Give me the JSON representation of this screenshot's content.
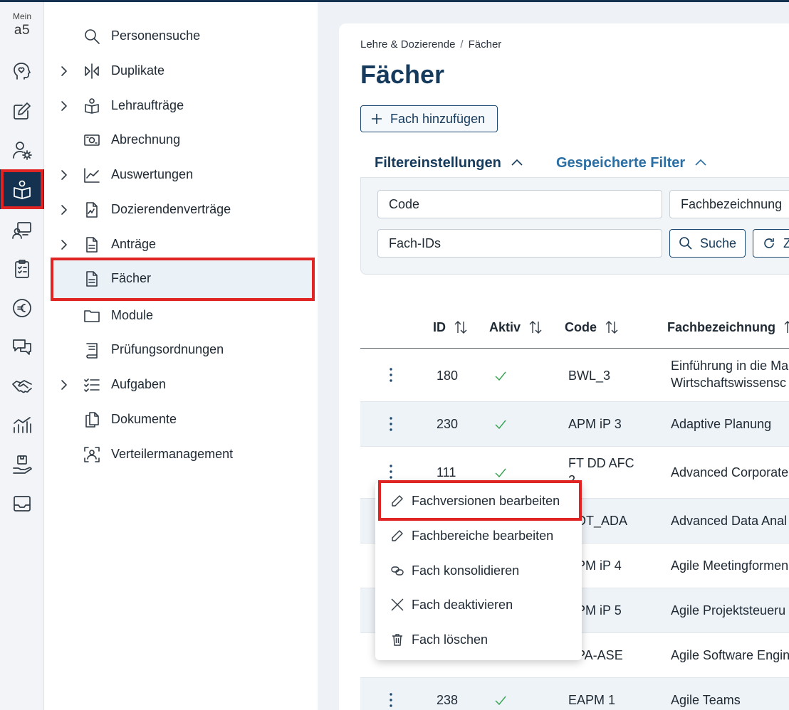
{
  "rail": {
    "brand_top": "Mein",
    "brand_logo": "a5",
    "icons": [
      "head-heart-icon",
      "edit-icon",
      "user-settings-icon",
      "teaching-book-icon",
      "presentation-user-icon",
      "clipboard-list-icon",
      "euro-icon",
      "chat-icon",
      "handshake-icon",
      "chart-icon",
      "hand-box-icon",
      "inbox-icon"
    ],
    "active_index": 3
  },
  "nav": {
    "items": [
      {
        "label": "Personensuche",
        "icon": "search-icon",
        "expandable": false
      },
      {
        "label": "Duplikate",
        "icon": "compare-icon",
        "expandable": true
      },
      {
        "label": "Lehraufträge",
        "icon": "book-user-icon",
        "expandable": true
      },
      {
        "label": "Abrechnung",
        "icon": "banknote-icon",
        "expandable": false
      },
      {
        "label": "Auswertungen",
        "icon": "line-chart-icon",
        "expandable": true
      },
      {
        "label": "Dozierendenverträge",
        "icon": "contract-icon",
        "expandable": true
      },
      {
        "label": "Anträge",
        "icon": "document-icon",
        "expandable": true
      },
      {
        "label": "Fächer",
        "icon": "document-icon",
        "expandable": false,
        "selected": true
      },
      {
        "label": "Module",
        "icon": "folder-icon",
        "expandable": false
      },
      {
        "label": "Prüfungsordnungen",
        "icon": "book-icon",
        "expandable": false
      },
      {
        "label": "Aufgaben",
        "icon": "checklist-icon",
        "expandable": true
      },
      {
        "label": "Dokumente",
        "icon": "documents-icon",
        "expandable": false
      },
      {
        "label": "Verteilermanagement",
        "icon": "group-scan-icon",
        "expandable": false
      }
    ]
  },
  "main": {
    "breadcrumb": [
      "Lehre & Dozierende",
      "Fächer"
    ],
    "breadcrumb_sep": "/",
    "title": "Fächer",
    "add_button": "Fach hinzufügen",
    "tabs": [
      "Filtereinstellungen",
      "Gespeicherte Filter"
    ],
    "filters": {
      "code_placeholder": "Code",
      "name_placeholder": "Fachbezeichnung",
      "ids_placeholder": "Fach-IDs",
      "search_button": "Suche",
      "reset_button": "Zurücksetzen"
    },
    "table": {
      "columns": [
        "ID",
        "Aktiv",
        "Code",
        "Fachbezeichnung"
      ],
      "rows": [
        {
          "id": "180",
          "active": true,
          "code": "BWL_3",
          "name": "Einführung in die Ma",
          "name2": "Wirtschaftswissensc"
        },
        {
          "id": "230",
          "active": true,
          "code": "APM iP 3",
          "name": "Adaptive Planung"
        },
        {
          "id": "111",
          "active": true,
          "code": "FT DD AFC",
          "code2": "2",
          "name": "Advanced Corporate"
        },
        {
          "id": "",
          "active": true,
          "code": "ADT_ADA",
          "name": "Advanced Data Anal"
        },
        {
          "id": "",
          "active": true,
          "code": "APM iP 4",
          "name": "Agile Meetingformen"
        },
        {
          "id": "",
          "active": true,
          "code": "APM iP 5",
          "name": "Agile Projektsteueru"
        },
        {
          "id": "",
          "active": true,
          "code": "APA-ASE",
          "name": "Agile Software Engin"
        },
        {
          "id": "238",
          "active": true,
          "code": "EAPM 1",
          "name": "Agile Teams"
        }
      ]
    }
  },
  "context_menu": {
    "items": [
      {
        "label": "Fachversionen bearbeiten",
        "icon": "pencil-icon"
      },
      {
        "label": "Fachbereiche bearbeiten",
        "icon": "pencil-icon"
      },
      {
        "label": "Fach konsolidieren",
        "icon": "merge-icon"
      },
      {
        "label": "Fach deaktivieren",
        "icon": "close-icon"
      },
      {
        "label": "Fach löschen",
        "icon": "trash-icon"
      }
    ]
  },
  "colors": {
    "brand_dark": "#14314f",
    "title": "#153a5b",
    "link": "#2a6ea3",
    "check": "#3aa655",
    "highlight": "#e02424"
  }
}
